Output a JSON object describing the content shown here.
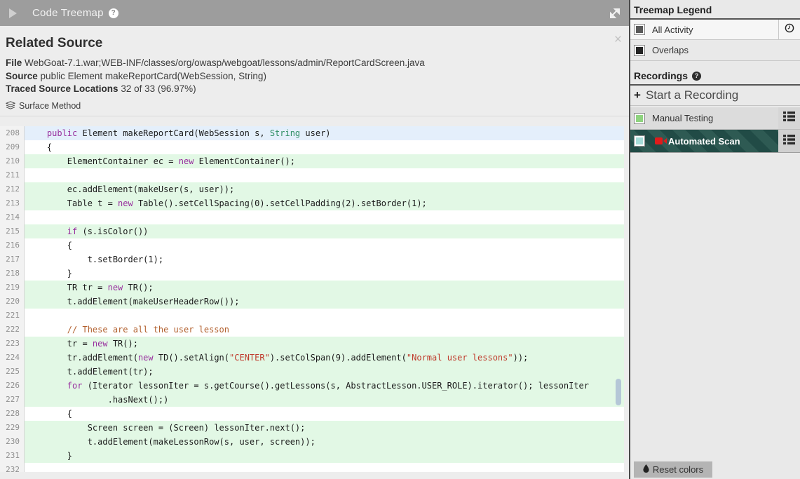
{
  "header": {
    "title": "Code Treemap",
    "help_icon": "?"
  },
  "panel": {
    "title": "Related Source",
    "close_icon": "×",
    "file_label": "File",
    "file_value": "WebGoat-7.1.war;WEB-INF/classes/org/owasp/webgoat/lessons/admin/ReportCardScreen.java",
    "source_label": "Source",
    "source_value": "public Element makeReportCard(WebSession, String)",
    "traced_label": "Traced Source Locations",
    "traced_value": "32 of 33 (96.97%)",
    "surface_method": "Surface Method"
  },
  "code": {
    "colors": {
      "keyword": "#982f9e",
      "type": "#2f8e63",
      "string": "#bf3a2b",
      "comment": "#b2602e",
      "plain": "#1a1a1a",
      "highlight_green": "#e2f8e5",
      "highlight_blue": "#e4effb"
    },
    "lines": [
      {
        "n": 208,
        "hl": "b",
        "ind": 4,
        "seg": [
          [
            "kw",
            "public"
          ],
          [
            "pl",
            " Element makeReportCard(WebSession s, "
          ],
          [
            "ty",
            "String"
          ],
          [
            "pl",
            " user)"
          ]
        ]
      },
      {
        "n": 209,
        "hl": "",
        "ind": 4,
        "seg": [
          [
            "pl",
            "{"
          ]
        ]
      },
      {
        "n": 210,
        "hl": "g",
        "ind": 8,
        "seg": [
          [
            "pl",
            "ElementContainer ec = "
          ],
          [
            "kw",
            "new"
          ],
          [
            "pl",
            " ElementContainer();"
          ]
        ]
      },
      {
        "n": 211,
        "hl": "",
        "ind": 0,
        "seg": []
      },
      {
        "n": 212,
        "hl": "g",
        "ind": 8,
        "seg": [
          [
            "pl",
            "ec.addElement(makeUser(s, user));"
          ]
        ]
      },
      {
        "n": 213,
        "hl": "g",
        "ind": 8,
        "seg": [
          [
            "pl",
            "Table t = "
          ],
          [
            "kw",
            "new"
          ],
          [
            "pl",
            " Table().setCellSpacing(0).setCellPadding(2).setBorder(1);"
          ]
        ]
      },
      {
        "n": 214,
        "hl": "",
        "ind": 0,
        "seg": []
      },
      {
        "n": 215,
        "hl": "g",
        "ind": 8,
        "seg": [
          [
            "kw",
            "if"
          ],
          [
            "pl",
            " (s.isColor())"
          ]
        ]
      },
      {
        "n": 216,
        "hl": "",
        "ind": 8,
        "seg": [
          [
            "pl",
            "{"
          ]
        ]
      },
      {
        "n": 217,
        "hl": "",
        "ind": 12,
        "seg": [
          [
            "pl",
            "t.setBorder(1);"
          ]
        ]
      },
      {
        "n": 218,
        "hl": "",
        "ind": 8,
        "seg": [
          [
            "pl",
            "}"
          ]
        ]
      },
      {
        "n": 219,
        "hl": "g",
        "ind": 8,
        "seg": [
          [
            "pl",
            "TR tr = "
          ],
          [
            "kw",
            "new"
          ],
          [
            "pl",
            " TR();"
          ]
        ]
      },
      {
        "n": 220,
        "hl": "g",
        "ind": 8,
        "seg": [
          [
            "pl",
            "t.addElement(makeUserHeaderRow());"
          ]
        ]
      },
      {
        "n": 221,
        "hl": "",
        "ind": 0,
        "seg": []
      },
      {
        "n": 222,
        "hl": "",
        "ind": 8,
        "seg": [
          [
            "com",
            "// These are all the user lesson"
          ]
        ]
      },
      {
        "n": 223,
        "hl": "g",
        "ind": 8,
        "seg": [
          [
            "pl",
            "tr = "
          ],
          [
            "kw",
            "new"
          ],
          [
            "pl",
            " TR();"
          ]
        ]
      },
      {
        "n": 224,
        "hl": "g",
        "ind": 8,
        "seg": [
          [
            "pl",
            "tr.addElement("
          ],
          [
            "kw",
            "new"
          ],
          [
            "pl",
            " TD().setAlign("
          ],
          [
            "str",
            "\"CENTER\""
          ],
          [
            "pl",
            ").setColSpan(9).addElement("
          ],
          [
            "str",
            "\"Normal user lessons\""
          ],
          [
            "pl",
            "));"
          ]
        ]
      },
      {
        "n": 225,
        "hl": "g",
        "ind": 8,
        "seg": [
          [
            "pl",
            "t.addElement(tr);"
          ]
        ]
      },
      {
        "n": 226,
        "hl": "g",
        "ind": 8,
        "seg": [
          [
            "kw",
            "for"
          ],
          [
            "pl",
            " (Iterator lessonIter = s.getCourse().getLessons(s, AbstractLesson.USER_ROLE).iterator(); lessonIter"
          ]
        ]
      },
      {
        "n": 227,
        "hl": "g",
        "ind": 16,
        "seg": [
          [
            "pl",
            ".hasNext();)"
          ]
        ]
      },
      {
        "n": 228,
        "hl": "",
        "ind": 8,
        "seg": [
          [
            "pl",
            "{"
          ]
        ]
      },
      {
        "n": 229,
        "hl": "g",
        "ind": 12,
        "seg": [
          [
            "pl",
            "Screen screen = (Screen) lessonIter.next();"
          ]
        ]
      },
      {
        "n": 230,
        "hl": "g",
        "ind": 12,
        "seg": [
          [
            "pl",
            "t.addElement(makeLessonRow(s, user, screen));"
          ]
        ]
      },
      {
        "n": 231,
        "hl": "g",
        "ind": 8,
        "seg": [
          [
            "pl",
            "}"
          ]
        ]
      },
      {
        "n": 232,
        "hl": "",
        "ind": 0,
        "seg": []
      }
    ]
  },
  "sidebar": {
    "legend_title": "Treemap Legend",
    "legend": [
      {
        "label": "All Activity",
        "color": "#585858"
      },
      {
        "label": "Overlaps",
        "color": "#242424"
      }
    ],
    "recordings_title": "Recordings",
    "recordings_help_icon": "?",
    "start_recording": "Start a Recording",
    "recordings": [
      {
        "label": "Manual Testing",
        "color": "#8fd37f"
      },
      {
        "label": "Automated Scan",
        "color": "#a6dcd8"
      }
    ],
    "selected_recording": "Automated Scan",
    "stripe_dark": "#214b46",
    "stripe_light": "#2e5a53",
    "reset_colors": "Reset colors"
  }
}
